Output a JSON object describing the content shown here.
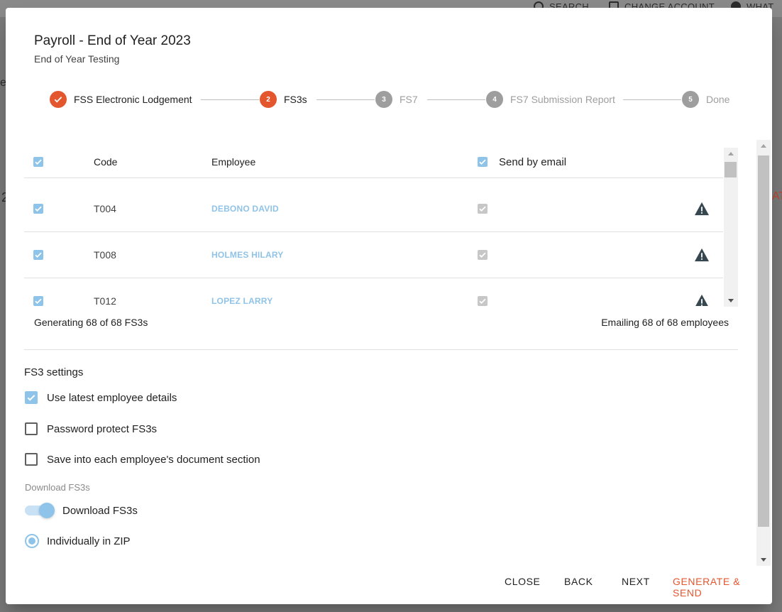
{
  "backdrop": {
    "actions": [
      "SEARCH",
      "CHANGE ACCOUNT",
      "WHAT"
    ],
    "edge_fragments": [
      "e",
      "2",
      "AT"
    ]
  },
  "dialog": {
    "title": "Payroll - End of Year 2023",
    "subtitle": "End of Year Testing"
  },
  "stepper": {
    "steps": [
      {
        "number": "1",
        "label": "FSS Electronic Lodgement",
        "state": "done"
      },
      {
        "number": "2",
        "label": "FS3s",
        "state": "active"
      },
      {
        "number": "3",
        "label": "FS7",
        "state": "pending"
      },
      {
        "number": "4",
        "label": "FS7 Submission Report",
        "state": "pending"
      },
      {
        "number": "5",
        "label": "Done",
        "state": "pending"
      }
    ]
  },
  "table": {
    "columns": {
      "code": "Code",
      "employee": "Employee",
      "send_by_email": "Send by email"
    },
    "rows": [
      {
        "code": "T004",
        "employee": "DEBONO DAVID",
        "selected": true,
        "email": true,
        "warning_icon": "warning-icon"
      },
      {
        "code": "T008",
        "employee": "HOLMES HILARY",
        "selected": true,
        "email": true,
        "warning_icon": "warning-icon"
      },
      {
        "code": "T012",
        "employee": "LOPEZ LARRY",
        "selected": true,
        "email": true,
        "warning_icon": "warning-icon"
      }
    ],
    "summary_left": "Generating 68 of 68 FS3s",
    "summary_right": "Emailing 68 of 68 employees"
  },
  "settings": {
    "title": "FS3 settings",
    "use_latest": {
      "label": "Use latest employee details",
      "checked": true
    },
    "password_protect": {
      "label": "Password protect FS3s",
      "checked": false
    },
    "save_documents": {
      "label": "Save into each employee's document section",
      "checked": false
    },
    "download_section_label": "Download FS3s",
    "download_toggle": {
      "label": "Download FS3s",
      "on": true
    },
    "download_mode": {
      "label": "Individually in ZIP",
      "selected": true
    }
  },
  "actions": {
    "close": "CLOSE",
    "back": "BACK",
    "next": "NEXT",
    "generate": "GENERATE & SEND"
  },
  "colors": {
    "accent": "#e4572e",
    "checkbox": "#8ec4ea",
    "link": "#90c3e8",
    "pending": "#9e9e9e"
  }
}
